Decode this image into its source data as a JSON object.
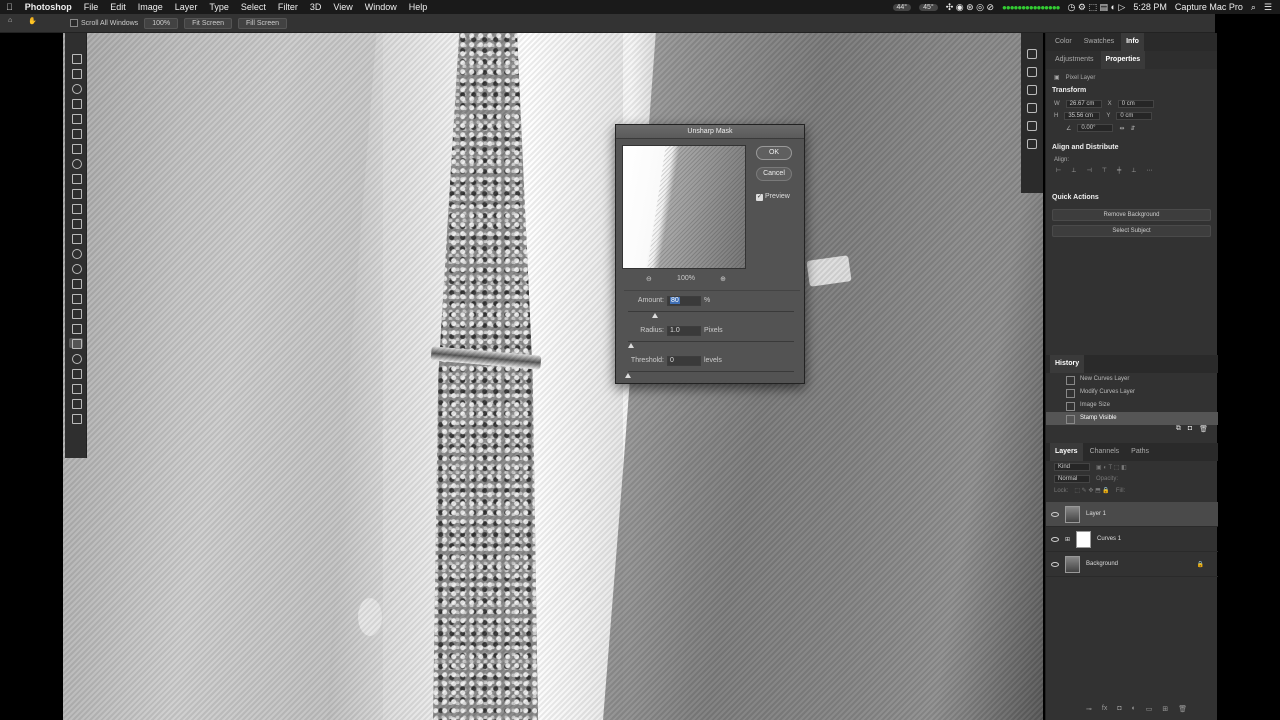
{
  "menubar": {
    "app": "Photoshop",
    "items": [
      "File",
      "Edit",
      "Image",
      "Layer",
      "Type",
      "Select",
      "Filter",
      "3D",
      "View",
      "Window",
      "Help"
    ],
    "status_cpu": "44°",
    "status_temp": "45°",
    "time": "5:28 PM",
    "user": "Capture Mac Pro"
  },
  "options": {
    "scroll_all": "Scroll All Windows",
    "zoom": "100%",
    "fit_screen_1": "Fit Screen",
    "fit_screen_2": "Fill Screen"
  },
  "panels_top": {
    "tabs": [
      "Color",
      "Swatches",
      "Info"
    ],
    "active_tab": "Info",
    "subtabs": [
      "Adjustments",
      "Properties"
    ],
    "active_subtab": "Properties",
    "layer_kind": "Pixel Layer",
    "transform_title": "Transform",
    "w_label": "W",
    "w_value": "26.67 cm",
    "x_label": "X",
    "x_value": "0 cm",
    "h_label": "H",
    "h_value": "35.56 cm",
    "y_label": "Y",
    "y_value": "0 cm",
    "angle_value": "0.00°",
    "align_title": "Align and Distribute",
    "align_label": "Align:",
    "quick_title": "Quick Actions",
    "remove_bg": "Remove Background",
    "select_subject": "Select Subject"
  },
  "history": {
    "title": "History",
    "items": [
      "New Curves Layer",
      "Modify Curves Layer",
      "Image Size",
      "Stamp Visible"
    ],
    "selected_index": 3
  },
  "layers": {
    "tabs": [
      "Layers",
      "Channels",
      "Paths"
    ],
    "active_tab": "Layers",
    "kind_label": "Kind",
    "mode": "Normal",
    "opacity_label": "Opacity:",
    "lock_label": "Lock:",
    "fill_label": "Fill:",
    "items": [
      {
        "name": "Layer 1",
        "selected": true
      },
      {
        "name": "Curves 1",
        "selected": false
      },
      {
        "name": "Background",
        "selected": false
      }
    ]
  },
  "dialog": {
    "title": "Unsharp Mask",
    "ok": "OK",
    "cancel": "Cancel",
    "preview_label": "Preview",
    "preview_checked": true,
    "zoom": "100%",
    "amount_label": "Amount:",
    "amount_value": "80",
    "amount_unit": "%",
    "amount_slider": 0.16,
    "radius_label": "Radius:",
    "radius_value": "1.0",
    "radius_unit": "Pixels",
    "radius_slider": 0.02,
    "threshold_label": "Threshold:",
    "threshold_value": "0",
    "threshold_unit": "levels",
    "threshold_slider": 0.0
  }
}
